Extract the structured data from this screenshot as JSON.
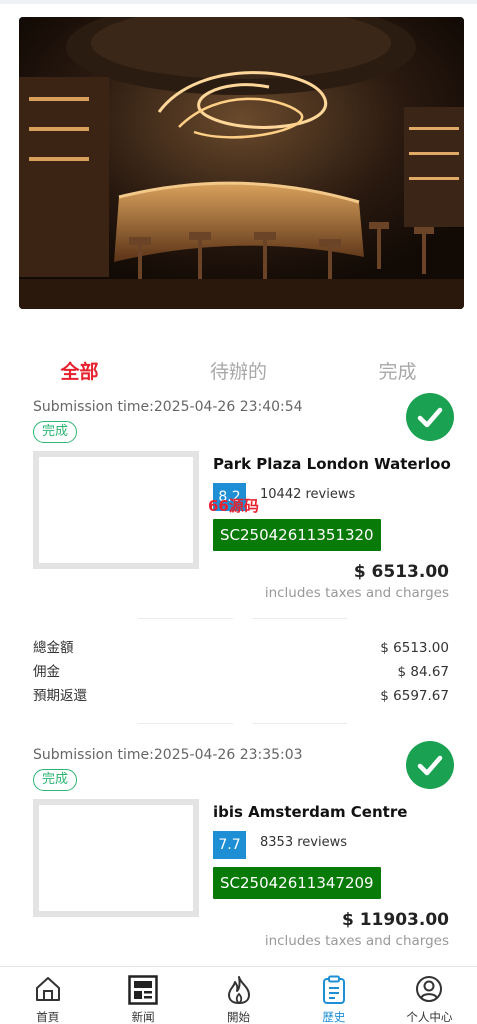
{
  "tabs": [
    {
      "label": "全部",
      "active": true
    },
    {
      "label": "待辦的",
      "active": false
    },
    {
      "label": "完成",
      "active": false
    }
  ],
  "orders": [
    {
      "submission_time": "Submission time:2025-04-26 23:40:54",
      "status": "完成",
      "hotel_name": "Park Plaza London Waterloo",
      "score": "8.2",
      "reviews": "10442 reviews",
      "order_code": "SC25042611351320",
      "price": "$ 6513.00",
      "taxes_note": "includes taxes and charges",
      "summary": [
        {
          "label": "總金額",
          "value": "$ 6513.00"
        },
        {
          "label": "佣金",
          "value": "$ 84.67"
        },
        {
          "label": "預期返還",
          "value": "$ 6597.67"
        }
      ]
    },
    {
      "submission_time": "Submission time:2025-04-26 23:35:03",
      "status": "完成",
      "hotel_name": "ibis Amsterdam Centre",
      "score": "7.7",
      "reviews": "8353 reviews",
      "order_code": "SC25042611347209",
      "price": "$ 11903.00",
      "taxes_note": "includes taxes and charges"
    }
  ],
  "watermark": "66源码",
  "nav": [
    {
      "label": "首頁",
      "icon": "home-icon",
      "active": false
    },
    {
      "label": "新闻",
      "icon": "news-icon",
      "active": false
    },
    {
      "label": "開始",
      "icon": "flame-icon",
      "active": false
    },
    {
      "label": "歷史",
      "icon": "clipboard-icon",
      "active": true
    },
    {
      "label": "个人中心",
      "icon": "user-icon",
      "active": false
    }
  ],
  "colors": {
    "accent_red": "#e8212e",
    "accent_blue": "#1e8fd5",
    "success_green": "#1aa152",
    "code_green": "#087a08"
  }
}
